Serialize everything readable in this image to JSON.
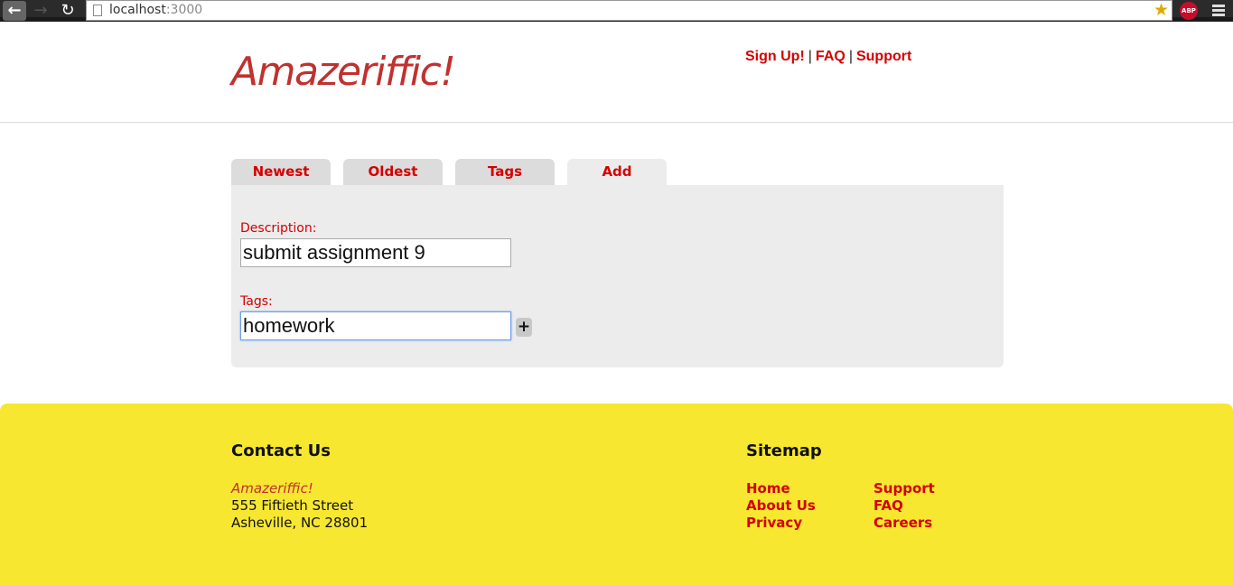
{
  "browser": {
    "url_host": "localhost",
    "url_port": ":3000",
    "extension_badge": "ABP"
  },
  "header": {
    "logo": "Amazeriffic!",
    "links": [
      "Sign Up!",
      "FAQ",
      "Support"
    ],
    "separator": "|"
  },
  "tabs": [
    {
      "label": "Newest",
      "active": false
    },
    {
      "label": "Oldest",
      "active": false
    },
    {
      "label": "Tags",
      "active": false
    },
    {
      "label": "Add",
      "active": true
    }
  ],
  "form": {
    "description_label": "Description:",
    "description_value": "submit assignment 9",
    "tags_label": "Tags:",
    "tags_value": "homework",
    "add_button_label": "+"
  },
  "footer": {
    "contact_heading": "Contact Us",
    "company": "Amazeriffic!",
    "street": "555 Fiftieth Street",
    "city": "Asheville, NC 28801",
    "sitemap_heading": "Sitemap",
    "sitemap_col1": [
      "Home",
      "About Us",
      "Privacy"
    ],
    "sitemap_col2": [
      "Support",
      "FAQ",
      "Careers"
    ]
  },
  "colors": {
    "brand_red": "#c0312f",
    "link_red": "#d40000",
    "footer_yellow": "#f7e731",
    "panel_gray": "#ececec"
  }
}
